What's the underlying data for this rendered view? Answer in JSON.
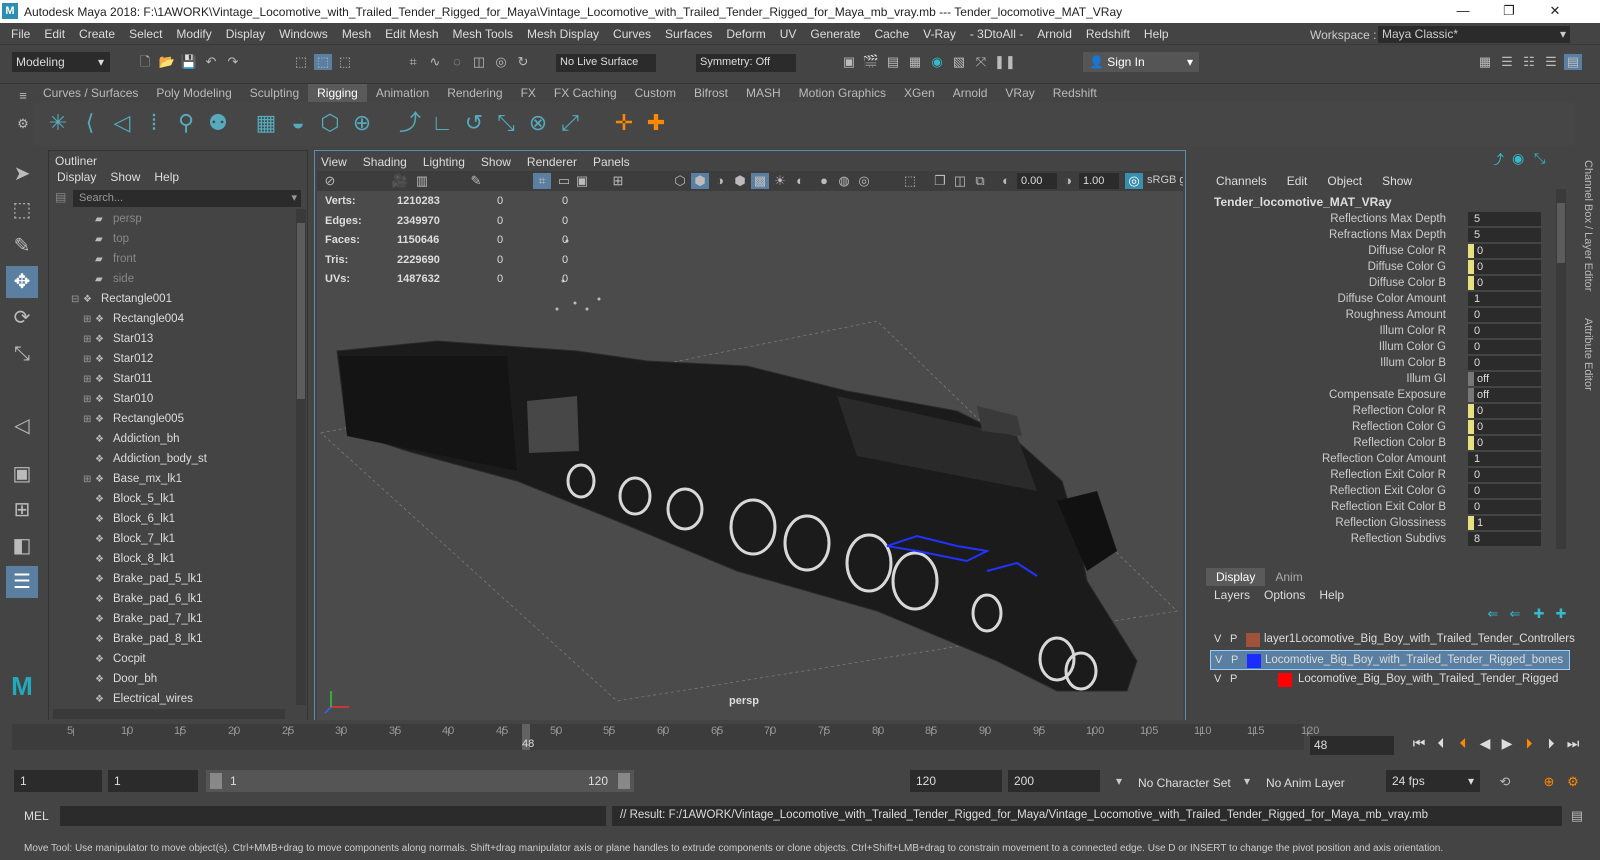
{
  "window": {
    "logo": "M",
    "title": "Autodesk Maya 2018: F:\\1AWORK\\Vintage_Locomotive_with_Trailed_Tender_Rigged_for_Maya\\Vintage_Locomotive_with_Trailed_Tender_Rigged_for_Maya_mb_vray.mb  ---   Tender_locomotive_MAT_VRay",
    "minimize": "—",
    "maximize": "❐",
    "close": "✕"
  },
  "menu": [
    "File",
    "Edit",
    "Create",
    "Select",
    "Modify",
    "Display",
    "Windows",
    "Mesh",
    "Edit Mesh",
    "Mesh Tools",
    "Mesh Display",
    "Curves",
    "Surfaces",
    "Deform",
    "UV",
    "Generate",
    "Cache",
    "V-Ray",
    "- 3DtoAll -",
    "Arnold",
    "Redshift",
    "Help"
  ],
  "workspace": {
    "label": "Workspace :",
    "value": "Maya Classic*"
  },
  "status": {
    "mode": "Modeling",
    "live_surface": "No Live Surface",
    "symmetry": "Symmetry: Off",
    "sign_in": "Sign In"
  },
  "shelf_tabs": [
    "Curves / Surfaces",
    "Poly Modeling",
    "Sculpting",
    "Rigging",
    "Animation",
    "Rendering",
    "FX",
    "FX Caching",
    "Custom",
    "Bifrost",
    "MASH",
    "Motion Graphics",
    "XGen",
    "Arnold",
    "VRay",
    "Redshift"
  ],
  "shelf_active": "Rigging",
  "outliner": {
    "title": "Outliner",
    "menu": [
      "Display",
      "Show",
      "Help"
    ],
    "search_placeholder": "Search...",
    "items": [
      {
        "label": "persp",
        "dim": true,
        "type": "camera",
        "indent": 1
      },
      {
        "label": "top",
        "dim": true,
        "type": "camera",
        "indent": 1
      },
      {
        "label": "front",
        "dim": true,
        "type": "camera",
        "indent": 1
      },
      {
        "label": "side",
        "dim": true,
        "type": "camera",
        "indent": 1
      },
      {
        "label": "Rectangle001",
        "type": "group",
        "expand": "⊟",
        "indent": 0
      },
      {
        "label": "Rectangle004",
        "type": "group",
        "expand": "⊞",
        "indent": 1
      },
      {
        "label": "Star013",
        "type": "group",
        "expand": "⊞",
        "indent": 1
      },
      {
        "label": "Star012",
        "type": "group",
        "expand": "⊞",
        "indent": 1
      },
      {
        "label": "Star011",
        "type": "group",
        "expand": "⊞",
        "indent": 1
      },
      {
        "label": "Star010",
        "type": "group",
        "expand": "⊞",
        "indent": 1
      },
      {
        "label": "Rectangle005",
        "type": "group",
        "expand": "⊞",
        "indent": 1
      },
      {
        "label": "Addiction_bh",
        "type": "mesh",
        "indent": 1
      },
      {
        "label": "Addiction_body_st",
        "type": "mesh",
        "indent": 1
      },
      {
        "label": "Base_mx_lk1",
        "type": "group",
        "expand": "⊞",
        "indent": 1
      },
      {
        "label": "Block_5_lk1",
        "type": "mesh",
        "indent": 1
      },
      {
        "label": "Block_6_lk1",
        "type": "mesh",
        "indent": 1
      },
      {
        "label": "Block_7_lk1",
        "type": "mesh",
        "indent": 1
      },
      {
        "label": "Block_8_lk1",
        "type": "mesh",
        "indent": 1
      },
      {
        "label": "Brake_pad_5_lk1",
        "type": "mesh",
        "indent": 1
      },
      {
        "label": "Brake_pad_6_lk1",
        "type": "mesh",
        "indent": 1
      },
      {
        "label": "Brake_pad_7_lk1",
        "type": "mesh",
        "indent": 1
      },
      {
        "label": "Brake_pad_8_lk1",
        "type": "mesh",
        "indent": 1
      },
      {
        "label": "Cocpit",
        "type": "mesh",
        "indent": 1
      },
      {
        "label": "Door_bh",
        "type": "mesh",
        "indent": 1
      },
      {
        "label": "Electrical_wires",
        "type": "mesh",
        "indent": 1
      }
    ]
  },
  "viewport": {
    "menu": [
      "View",
      "Shading",
      "Lighting",
      "Show",
      "Renderer",
      "Panels"
    ],
    "exposure": "0.00",
    "gamma": "1.00",
    "colorspace": "sRGB gam",
    "camera": "persp",
    "hud": [
      {
        "label": "Verts:",
        "v1": "1210283",
        "v2": "0",
        "v3": "0"
      },
      {
        "label": "Edges:",
        "v1": "2349970",
        "v2": "0",
        "v3": "0"
      },
      {
        "label": "Faces:",
        "v1": "1150646",
        "v2": "0",
        "v3": "0"
      },
      {
        "label": "Tris:",
        "v1": "2229690",
        "v2": "0",
        "v3": "0"
      },
      {
        "label": "UVs:",
        "v1": "1487632",
        "v2": "0",
        "v3": "0"
      }
    ]
  },
  "channel_box": {
    "menu": [
      "Channels",
      "Edit",
      "Object",
      "Show"
    ],
    "node": "Tender_locomotive_MAT_VRay",
    "rows": [
      {
        "name": "Reflections Max Depth",
        "value": "5",
        "keyed": false
      },
      {
        "name": "Refractions Max Depth",
        "value": "5",
        "keyed": false
      },
      {
        "name": "Diffuse Color R",
        "value": "0",
        "keyed": true
      },
      {
        "name": "Diffuse Color G",
        "value": "0",
        "keyed": true
      },
      {
        "name": "Diffuse Color B",
        "value": "0",
        "keyed": true
      },
      {
        "name": "Diffuse Color Amount",
        "value": "1",
        "keyed": false
      },
      {
        "name": "Roughness Amount",
        "value": "0",
        "keyed": false
      },
      {
        "name": "Illum Color R",
        "value": "0",
        "keyed": false
      },
      {
        "name": "Illum Color G",
        "value": "0",
        "keyed": false
      },
      {
        "name": "Illum Color B",
        "value": "0",
        "keyed": false
      },
      {
        "name": "Illum GI",
        "value": "off",
        "flag": true
      },
      {
        "name": "Compensate Exposure",
        "value": "off",
        "flag": true
      },
      {
        "name": "Reflection Color R",
        "value": "0",
        "keyed": true
      },
      {
        "name": "Reflection Color G",
        "value": "0",
        "keyed": true
      },
      {
        "name": "Reflection Color B",
        "value": "0",
        "keyed": true
      },
      {
        "name": "Reflection Color Amount",
        "value": "1",
        "keyed": false
      },
      {
        "name": "Reflection Exit Color R",
        "value": "0",
        "keyed": false
      },
      {
        "name": "Reflection Exit Color G",
        "value": "0",
        "keyed": false
      },
      {
        "name": "Reflection Exit Color B",
        "value": "0",
        "keyed": false
      },
      {
        "name": "Reflection Glossiness",
        "value": "1",
        "keyed": true
      },
      {
        "name": "Reflection Subdivs",
        "value": "8",
        "keyed": false
      }
    ]
  },
  "side_tabs": {
    "channel_box": "Channel Box / Layer Editor",
    "attribute": "Attribute Editor"
  },
  "layers": {
    "tabs": [
      "Display",
      "Anim"
    ],
    "menu": [
      "Layers",
      "Options",
      "Help"
    ],
    "items": [
      {
        "v": "V",
        "p": "P",
        "color": "#a0513a",
        "name": "layer1Locomotive_Big_Boy_with_Trailed_Tender_Controllers",
        "selected": false
      },
      {
        "v": "V",
        "p": "P",
        "color": "#1a2cff",
        "name": "Locomotive_Big_Boy_with_Trailed_Tender_Rigged_bones",
        "selected": true
      },
      {
        "v": "V",
        "p": "P",
        "color": "#ff0000",
        "name": "Locomotive_Big_Boy_with_Trailed_Tender_Rigged",
        "selected": false
      }
    ]
  },
  "timeline": {
    "ticks": [
      "5",
      "10",
      "15",
      "20",
      "25",
      "30",
      "35",
      "40",
      "45",
      "50",
      "55",
      "60",
      "65",
      "70",
      "75",
      "80",
      "85",
      "90",
      "95",
      "100",
      "105",
      "110",
      "115",
      "120"
    ],
    "current": "48",
    "current_field": "48"
  },
  "range": {
    "start": "1",
    "playback_start": "1",
    "slider_start": "1",
    "slider_end": "120",
    "playback_end": "120",
    "end": "200",
    "character_set": "No Character Set",
    "anim_layer": "No Anim Layer",
    "fps": "24 fps"
  },
  "command": {
    "mel": "MEL",
    "result": "// Result: F:/1AWORK/Vintage_Locomotive_with_Trailed_Tender_Rigged_for_Maya/Vintage_Locomotive_with_Trailed_Tender_Rigged_for_Maya_mb_vray.mb"
  },
  "help_line": "Move Tool: Use manipulator to move object(s). Ctrl+MMB+drag to move components along normals. Shift+drag manipulator axis or plane handles to extrude components or clone objects. Ctrl+Shift+LMB+drag to constrain movement to a connected edge. Use D or INSERT to change the pivot position and axis orientation."
}
